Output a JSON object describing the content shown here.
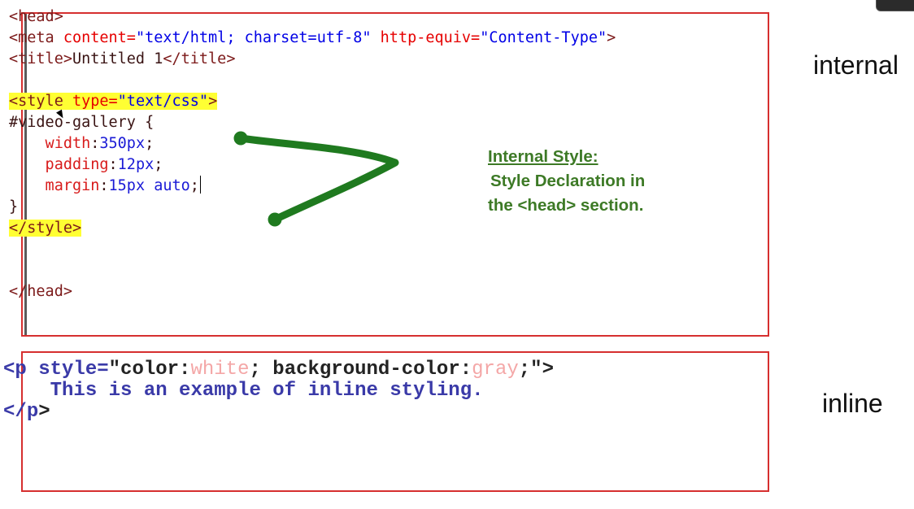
{
  "internal_panel": {
    "lines": [
      {
        "segments": [
          {
            "text": "<head>",
            "cls": "t-tag"
          }
        ]
      },
      {
        "segments": [
          {
            "text": "<meta ",
            "cls": "t-tag"
          },
          {
            "text": "content=",
            "cls": "t-attr"
          },
          {
            "text": "\"text/html; charset=utf-8\"",
            "cls": "t-str"
          },
          {
            "text": " http-equiv=",
            "cls": "t-attr"
          },
          {
            "text": "\"Content-Type\"",
            "cls": "t-str"
          },
          {
            "text": ">",
            "cls": "t-tag"
          }
        ]
      },
      {
        "segments": [
          {
            "text": "<title>",
            "cls": "t-tag"
          },
          {
            "text": "Untitled 1",
            "cls": "t-dark"
          },
          {
            "text": "</title>",
            "cls": "t-tag"
          }
        ]
      },
      {
        "segments": [
          {
            "text": "",
            "cls": ""
          }
        ]
      },
      {
        "segments": [
          {
            "text": "<style ",
            "cls": "t-tag hl"
          },
          {
            "text": "type=",
            "cls": "t-attr hl"
          },
          {
            "text": "\"text/css\"",
            "cls": "t-str hl"
          },
          {
            "text": ">",
            "cls": "t-tag hl"
          }
        ]
      },
      {
        "segments": [
          {
            "text": "#video-gallery {",
            "cls": "t-dark"
          }
        ]
      },
      {
        "segments": [
          {
            "text": "    width",
            "cls": "t-red"
          },
          {
            "text": ":",
            "cls": "t-dark"
          },
          {
            "text": "350px",
            "cls": "t-blue"
          },
          {
            "text": ";",
            "cls": "t-dark"
          }
        ]
      },
      {
        "segments": [
          {
            "text": "    padding",
            "cls": "t-red"
          },
          {
            "text": ":",
            "cls": "t-dark"
          },
          {
            "text": "12px",
            "cls": "t-blue"
          },
          {
            "text": ";",
            "cls": "t-dark"
          }
        ]
      },
      {
        "segments": [
          {
            "text": "    margin",
            "cls": "t-red"
          },
          {
            "text": ":",
            "cls": "t-dark"
          },
          {
            "text": "15px auto",
            "cls": "t-blue"
          },
          {
            "text": ";",
            "cls": "t-dark"
          }
        ],
        "caret": true
      },
      {
        "segments": [
          {
            "text": "}",
            "cls": "t-dark"
          }
        ]
      },
      {
        "segments": [
          {
            "text": "</style>",
            "cls": "t-tag hl"
          }
        ]
      },
      {
        "segments": [
          {
            "text": "",
            "cls": ""
          }
        ]
      },
      {
        "segments": [
          {
            "text": "",
            "cls": ""
          }
        ]
      },
      {
        "segments": [
          {
            "text": "</head>",
            "cls": "t-tag"
          }
        ]
      }
    ],
    "note": {
      "title": "Internal Style:",
      "line2": "Style Declaration in",
      "line3": "the <head> section."
    },
    "accent_color": "#1f7a1f"
  },
  "inline_panel": {
    "lines": [
      {
        "segments": [
          {
            "text": "<p ",
            "cls": "i-blue"
          },
          {
            "text": "style=",
            "cls": "i-blue"
          },
          {
            "text": "\"color:",
            "cls": "i-dark"
          },
          {
            "text": "white",
            "cls": "i-faint"
          },
          {
            "text": "; background-color:",
            "cls": "i-dark"
          },
          {
            "text": "gray",
            "cls": "i-faint"
          },
          {
            "text": ";\"",
            "cls": "i-dark"
          },
          {
            "text": ">",
            "cls": "i-dark"
          }
        ]
      },
      {
        "segments": [
          {
            "text": "    This is an example of inline styling.",
            "cls": "i-blue"
          }
        ]
      },
      {
        "segments": [
          {
            "text": "</",
            "cls": "i-blue"
          },
          {
            "text": "p",
            "cls": "i-blue"
          },
          {
            "text": ">",
            "cls": "i-dark"
          }
        ]
      }
    ]
  },
  "labels": {
    "internal": "internal",
    "inline": "inline"
  },
  "colors": {
    "panel_border": "#d62f2f",
    "highlight": "#ffff33",
    "note_green": "#3d7a26"
  }
}
